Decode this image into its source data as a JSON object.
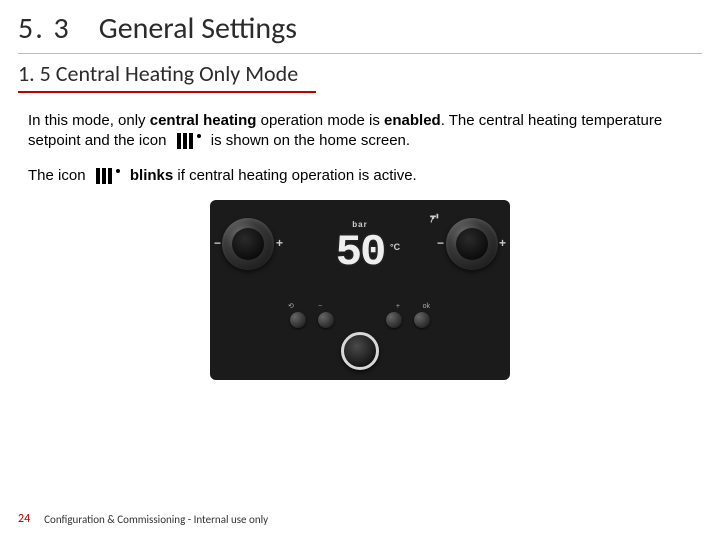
{
  "header": {
    "section_number": "5. 3",
    "section_title": "General Settings",
    "subsection": "1. 5 Central Heating Only Mode"
  },
  "body": {
    "p1_a": "In this mode, only ",
    "p1_b": "central heating",
    "p1_c": " operation mode is ",
    "p1_d": "enabled",
    "p1_e": ". The central heating temperature setpoint and the icon",
    "p1_f": "is shown on the home screen.",
    "p2_a": "The icon",
    "p2_b": "blinks",
    "p2_c": " if central heating operation is active."
  },
  "panel": {
    "display_value": "50",
    "bar_label": "bar",
    "unit": "°C",
    "minus": "−",
    "plus": "+"
  },
  "footer": {
    "page": "24",
    "text": "Configuration & Commissioning - Internal use only"
  }
}
